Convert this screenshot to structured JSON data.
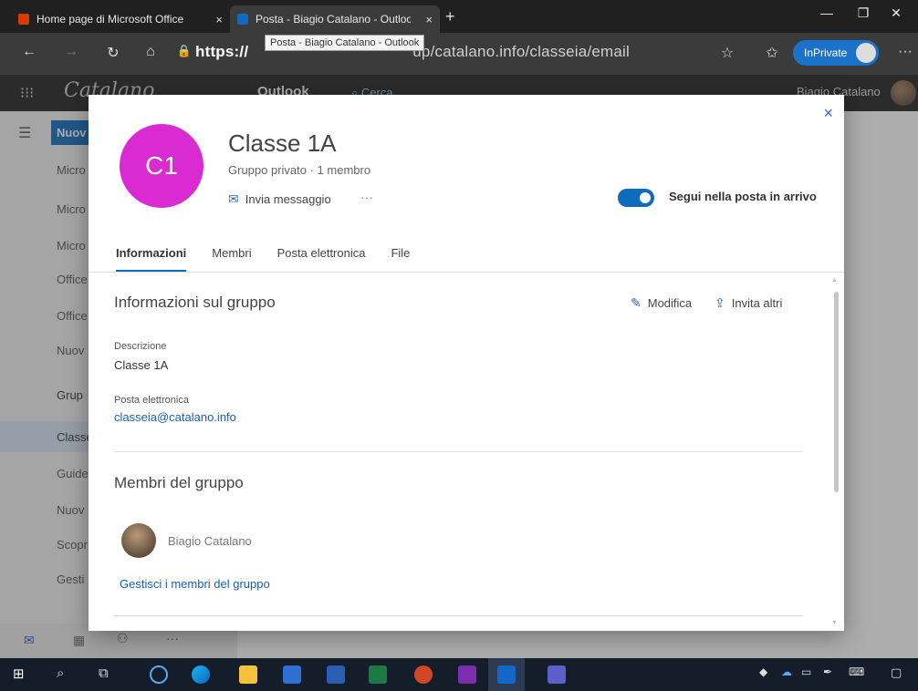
{
  "browser": {
    "tabs": [
      {
        "title": "Home page di Microsoft Office",
        "close": "×",
        "favicon_color": "#d83b01"
      },
      {
        "title": "Posta - Biagio Catalano - Outlook",
        "close": "×",
        "favicon_color": "#0f6cbd"
      }
    ],
    "new_tab": "+",
    "window_controls": [
      "—",
      "❐",
      "✕"
    ],
    "url_prefix": "https://",
    "url_suffix": "up/catalano.info/classeia/email",
    "tooltip": "Posta - Biagio Catalano - Outlook",
    "inprivate_label": "InPrivate",
    "nav_icons": [
      "←",
      "→",
      "↻",
      "⌂",
      "🔒"
    ],
    "right_icons": [
      "☆",
      "✩",
      "···"
    ]
  },
  "owa_header": {
    "org_logo_text": "Catalano",
    "app_name": "Outlook",
    "search_placeholder": "Cerca",
    "user_name": "Biagio Catalano"
  },
  "leftnav": {
    "new_button": "Nuov",
    "items": [
      "Micro",
      "Micro",
      "Micro",
      "Office",
      "Office",
      "Nuov",
      "Grup",
      "Classe",
      "Guide",
      "Nuov",
      "Scopr",
      "Gesti"
    ]
  },
  "group": {
    "initials": "C1",
    "avatar_color": "#d92bd1",
    "name": "Classe 1A",
    "meta": "Gruppo privato · 1 membro",
    "send_message": "Invia messaggio",
    "more": "···",
    "follow_label": "Segui nella posta in arrivo",
    "follow_on": true,
    "close": "×"
  },
  "tabs": [
    {
      "label": "Informazioni",
      "active": true
    },
    {
      "label": "Membri",
      "active": false
    },
    {
      "label": "Posta elettronica",
      "active": false
    },
    {
      "label": "File",
      "active": false
    }
  ],
  "info": {
    "section_title": "Informazioni sul gruppo",
    "edit_label": "Modifica",
    "invite_label": "Invita altri",
    "description_label": "Descrizione",
    "description_value": "Classe 1A",
    "email_label": "Posta elettronica",
    "email_value": "classeia@catalano.info"
  },
  "members": {
    "section_title": "Membri del gruppo",
    "list": [
      {
        "name": "Biagio Catalano"
      }
    ],
    "manage_link": "Gestisci i membri del gruppo"
  },
  "colors": {
    "accent": "#0f6cbd",
    "link": "#1a5fb4"
  }
}
